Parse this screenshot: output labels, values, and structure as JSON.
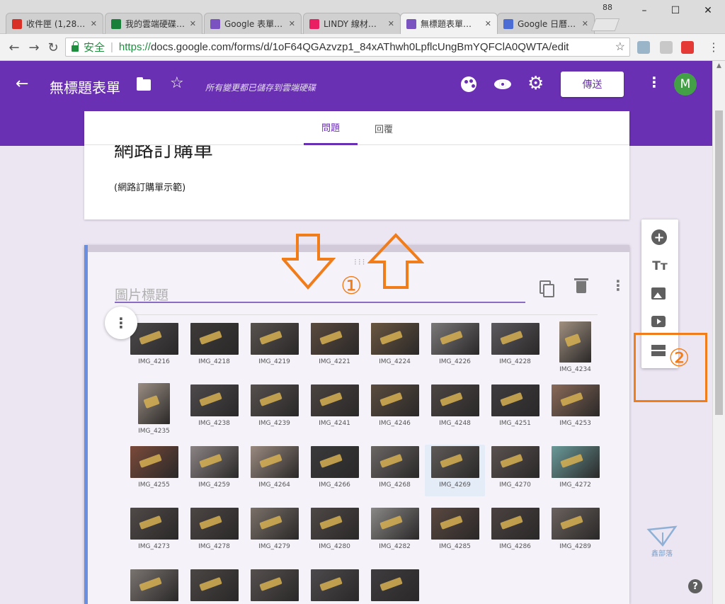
{
  "browser": {
    "tabs": [
      {
        "title": "收件匣 (1,28…",
        "favicon": "gmail-icon",
        "color": "#d93025"
      },
      {
        "title": "我的雲端硬碟…",
        "favicon": "drive-icon",
        "color": "#188038"
      },
      {
        "title": "Google 表單…",
        "favicon": "forms-icon",
        "color": "#7b53c1"
      },
      {
        "title": "LINDY 線材…",
        "favicon": "blog-icon",
        "color": "#e91e63"
      },
      {
        "title": "無標題表單…",
        "favicon": "forms-icon",
        "color": "#7b53c1"
      },
      {
        "title": "Google 日曆…",
        "favicon": "calendar-icon",
        "color": "#4a6cd4"
      }
    ],
    "tab_count": "88",
    "window_controls": {
      "minimize": "–",
      "maximize": "☐",
      "close": "✕"
    },
    "address_bar": {
      "secure_label": "安全",
      "url_scheme": "https://",
      "url_rest": "docs.google.com/forms/d/1oF64QGAzvzp1_84xAThwh0LpflcUngBmYQFClA0QWTA/edit"
    }
  },
  "header": {
    "title": "無標題表單",
    "save_status": "所有變更都已儲存到雲端硬碟",
    "send_label": "傳送",
    "avatar_initial": "M",
    "back_icon": "←",
    "star_icon": "☆",
    "gear_icon": "⚙",
    "more_icon": "⋮",
    "accent_color": "#6a30b3"
  },
  "form": {
    "tabs": {
      "questions": "問題",
      "responses": "回覆"
    },
    "title": "網路訂購單",
    "description": "(網路訂購單示範)"
  },
  "image_question": {
    "title_placeholder": "圖片標題",
    "drag_icon": "⁝⁝⁝",
    "more_icon": "⋮",
    "images": [
      {
        "name": "IMG_4216",
        "tone": "#4d4a4c"
      },
      {
        "name": "IMG_4218",
        "tone": "#3e3a3a"
      },
      {
        "name": "IMG_4219",
        "tone": "#58524e"
      },
      {
        "name": "IMG_4221",
        "tone": "#5a4a3e"
      },
      {
        "name": "IMG_4224",
        "tone": "#6a5640"
      },
      {
        "name": "IMG_4226",
        "tone": "#7a7878"
      },
      {
        "name": "IMG_4228",
        "tone": "#5c5a5e"
      },
      {
        "name": "IMG_4234",
        "tone": "#a09080"
      },
      {
        "name": "IMG_4235",
        "tone": "#9b8e83"
      },
      {
        "name": "IMG_4238",
        "tone": "#4e4a4c"
      },
      {
        "name": "IMG_4239",
        "tone": "#55504e"
      },
      {
        "name": "IMG_4241",
        "tone": "#4a4340"
      },
      {
        "name": "IMG_4246",
        "tone": "#5a4c3e"
      },
      {
        "name": "IMG_4248",
        "tone": "#4c4644"
      },
      {
        "name": "IMG_4251",
        "tone": "#3e3c3e"
      },
      {
        "name": "IMG_4253",
        "tone": "#8a6a58"
      },
      {
        "name": "IMG_4255",
        "tone": "#7a4a3a"
      },
      {
        "name": "IMG_4259",
        "tone": "#8c8484"
      },
      {
        "name": "IMG_4264",
        "tone": "#9a8a80"
      },
      {
        "name": "IMG_4266",
        "tone": "#3a3a3c"
      },
      {
        "name": "IMG_4268",
        "tone": "#6a6664"
      },
      {
        "name": "IMG_4269",
        "tone": "#5e5a58"
      },
      {
        "name": "IMG_4270",
        "tone": "#5a5250"
      },
      {
        "name": "IMG_4272",
        "tone": "#6a9a9a"
      },
      {
        "name": "IMG_4273",
        "tone": "#504a48"
      },
      {
        "name": "IMG_4278",
        "tone": "#4c4644"
      },
      {
        "name": "IMG_4279",
        "tone": "#7a7068"
      },
      {
        "name": "IMG_4280",
        "tone": "#4e4846"
      },
      {
        "name": "IMG_4282",
        "tone": "#8a8886"
      },
      {
        "name": "IMG_4285",
        "tone": "#5a4840"
      },
      {
        "name": "IMG_4286",
        "tone": "#4a4240"
      },
      {
        "name": "IMG_4289",
        "tone": "#6a625e"
      },
      {
        "name": "",
        "tone": "#7a7470"
      },
      {
        "name": "",
        "tone": "#4a4644"
      },
      {
        "name": "",
        "tone": "#55504e"
      },
      {
        "name": "",
        "tone": "#4c4a4c"
      },
      {
        "name": "",
        "tone": "#3e3c3e"
      }
    ],
    "selected_image": "IMG_4269"
  },
  "side_toolbar": {
    "add_question_icon": "+",
    "title_icon": "Tт"
  },
  "annotations": {
    "step1": "①",
    "step2": "②",
    "color": "#f07c1a"
  },
  "help_icon": "?",
  "watermark": "鑫部落"
}
